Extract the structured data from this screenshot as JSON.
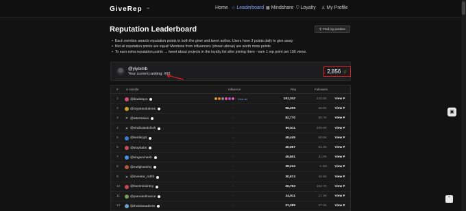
{
  "brand": {
    "name": "GiveRep",
    "badge": "⁹ᵏ"
  },
  "nav": [
    {
      "label": "Home",
      "icon": ""
    },
    {
      "label": "Leaderboard",
      "icon": "star-icon"
    },
    {
      "label": "Mindshare",
      "icon": "grid-icon"
    },
    {
      "label": "Loyalty",
      "icon": "shield-icon"
    },
    {
      "label": "My Profile",
      "icon": "user-icon"
    }
  ],
  "page": {
    "title": "Reputation Leaderboard",
    "find_button": "Find my position"
  },
  "info": [
    "Each mention awards reputation points to both the giver and tweet author. Users have 3 points daily to give away.",
    "Not all reputation points are equal! Mentions from influencers (shown above) are worth more points.",
    "To earn extra reputation points → tweet about projects in the loyalty list after joining them - earn 1 rep point per 100 views."
  ],
  "user": {
    "handle": "@yiyixmb",
    "ranking": "Your current ranking: #92",
    "score": "2,856"
  },
  "table": {
    "headers": {
      "rank": "#",
      "handle": "X Handle",
      "influence": "Influence",
      "rep": "Rep",
      "followers": "Followers"
    },
    "view_all": "View all",
    "rows": [
      {
        "rank": "1",
        "handle": "@ikadotayo",
        "influence": "",
        "rep": "191,342",
        "followers": "233.6K",
        "view": "View",
        "avatar": "#d14f79"
      },
      {
        "rank": "2",
        "handle": "@cryptosolutions",
        "influence": "-",
        "rep": "96,209",
        "followers": "33.5K",
        "view": "View",
        "avatar": "#c8a030"
      },
      {
        "rank": "3",
        "handle": "@attentoken",
        "influence": "-",
        "rep": "82,770",
        "followers": "89.7K",
        "view": "View",
        "avatar": ""
      },
      {
        "rank": "4",
        "handle": "@vindicatedchick",
        "influence": "-",
        "rep": "60,511",
        "followers": "209.6K",
        "view": "View",
        "avatar": ""
      },
      {
        "rank": "5",
        "handle": "@kenikrypt",
        "influence": "-",
        "rep": "49,445",
        "followers": "66.6K",
        "view": "View",
        "avatar": "#3a7bd5"
      },
      {
        "rank": "6",
        "handle": "@kraybabs",
        "influence": "-",
        "rep": "40,067",
        "followers": "84.3K",
        "view": "View",
        "avatar": "#c74b6a"
      },
      {
        "rank": "7",
        "handle": "@kingsecheeh",
        "influence": "-",
        "rep": "45,801",
        "followers": "41.0K",
        "view": "View",
        "avatar": "#4a8fe7"
      },
      {
        "rank": "8",
        "handle": "@melglosmhq",
        "influence": "-",
        "rep": "39,244",
        "followers": "1.3M",
        "view": "View",
        "avatar": "#b05a3a"
      },
      {
        "rank": "9",
        "handle": "@investor_ruthh",
        "influence": "-",
        "rep": "30,674",
        "followers": "44.5K",
        "view": "View",
        "avatar": ""
      },
      {
        "rank": "10",
        "handle": "@hominimiintny",
        "influence": "-",
        "rep": "25,763",
        "followers": "182.7K",
        "view": "View",
        "avatar": "#c64a58"
      },
      {
        "rank": "11",
        "handle": "@yaenatofinance",
        "influence": "-",
        "rep": "24,911",
        "followers": "17.3K",
        "view": "View",
        "avatar": "#7a9a5a"
      },
      {
        "rank": "12",
        "handle": "@tholvianadzm8",
        "influence": "-",
        "rep": "21,289",
        "followers": "47.2K",
        "view": "View",
        "avatar": "#6aa0c8"
      }
    ]
  },
  "influencer_icons": [
    "#c9a227",
    "#e07b39",
    "#8a8a8a",
    "#e94f8a",
    "#a84fd8",
    "#e05ca0"
  ]
}
